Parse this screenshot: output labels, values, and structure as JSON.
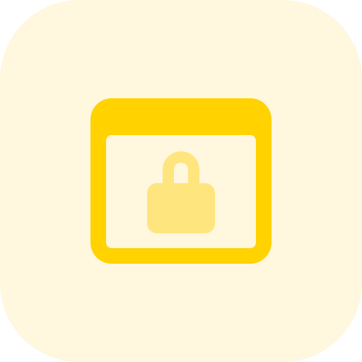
{
  "icon": {
    "name": "secure-browser-window-icon",
    "parts": [
      "background-tile",
      "browser-window",
      "padlock"
    ]
  },
  "colors": {
    "tile_background": "#FFF7DE",
    "window_frame": "#FFD200",
    "window_body": "#FFF7DE",
    "lock_body": "#FFE57E",
    "lock_shackle": "#FFE57E"
  }
}
